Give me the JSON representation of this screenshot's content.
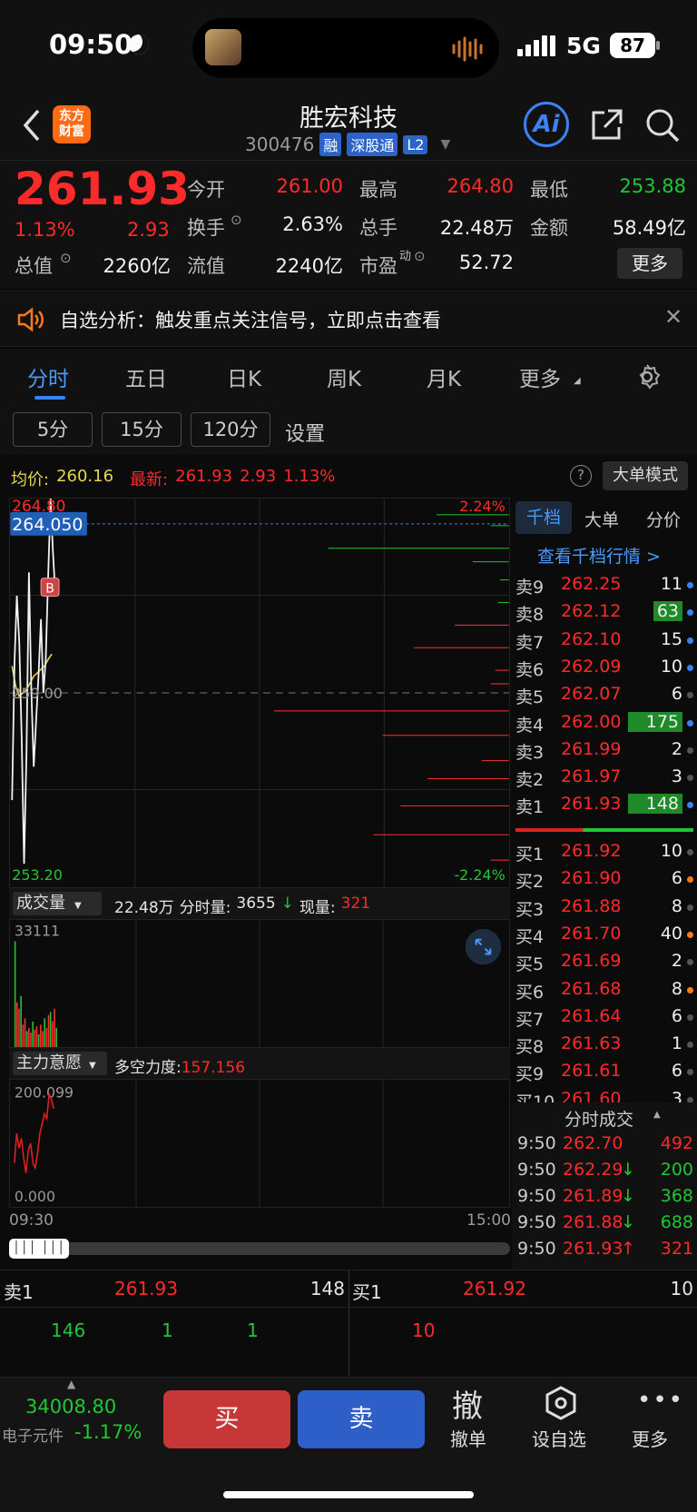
{
  "status_bar": {
    "time": "09:50",
    "network": "5G",
    "battery": "87"
  },
  "header": {
    "logo_line1": "东方",
    "logo_line2": "财富",
    "title": "胜宏科技",
    "code": "300476",
    "tags": [
      "融",
      "深股通",
      "L2"
    ],
    "ai_label": "Ai"
  },
  "quote": {
    "price": "261.93",
    "pct": "1.13%",
    "change": "2.93",
    "today_open_label": "今开",
    "today_open": "261.00",
    "high_label": "最高",
    "high": "264.80",
    "low_label": "最低",
    "low": "253.88",
    "turnover_label": "换手",
    "turnover": "2.63%",
    "volume_label": "总手",
    "volume": "22.48万",
    "amount_label": "金额",
    "amount": "58.49亿",
    "mktcap_label": "总值",
    "mktcap": "2260亿",
    "float_label": "流值",
    "float": "2240亿",
    "pe_label": "市盈",
    "pe_sup": "动",
    "pe": "52.72",
    "more": "更多"
  },
  "notice": {
    "text": "自选分析：触发重点关注信号，立即点击查看"
  },
  "tabs": [
    "分时",
    "五日",
    "日K",
    "周K",
    "月K",
    "更多"
  ],
  "subtabs": [
    "5分",
    "15分",
    "120分"
  ],
  "settings_label": "设置",
  "infobar": {
    "avg_label": "均价:",
    "avg": "260.16",
    "latest_label": "最新:",
    "latest": "261.93",
    "change": "2.93",
    "pct": "1.13%",
    "mode": "大单模式"
  },
  "chart_data": {
    "type": "line",
    "title": "",
    "x_start": "09:30",
    "x_end": "15:00",
    "y_top": "264.80",
    "y_bottom": "253.20",
    "pct_top": "2.24%",
    "pct_bottom": "-2.24%",
    "crosshair": "264.050",
    "ref_price": "259.00",
    "marker": "B",
    "price_series": [
      255.8,
      259.9,
      261.9,
      260.5,
      257.6,
      253.9,
      257.2,
      262.6,
      259.1,
      256.8,
      258.2,
      259.5,
      261.2,
      259.0,
      260.0,
      262.5,
      264.8,
      263.2,
      261.9
    ],
    "avg_series": [
      259.8,
      259.2,
      258.9,
      259.0,
      259.1,
      259.3,
      259.5,
      259.6,
      259.7,
      259.8,
      260.0,
      260.16
    ]
  },
  "volume": {
    "label": "成交量",
    "total": "22.48万",
    "minute_label": "分时量:",
    "minute": "3655",
    "now_label": "现量:",
    "now": "321",
    "max": "33111",
    "bars": [
      33111,
      14000,
      12000,
      16000,
      7000,
      9000,
      5000,
      6000,
      4500,
      8000,
      5500,
      6500,
      4000,
      7000,
      5000,
      9000,
      6000,
      10000,
      11000,
      8000,
      12000,
      6000
    ]
  },
  "zhuli": {
    "label": "主力意愿",
    "strength_label": "多空力度:",
    "strength": "157.156",
    "max": "200.099",
    "min": "0.000",
    "series": [
      60,
      120,
      90,
      110,
      70,
      40,
      85,
      100,
      60,
      50,
      80,
      120,
      140,
      160,
      150,
      200,
      190,
      170
    ]
  },
  "orderbook": {
    "tabs": [
      "千档",
      "大单",
      "分价"
    ],
    "link": "查看千档行情 >",
    "asks": [
      {
        "label": "卖9",
        "price": "262.25",
        "vol": "11"
      },
      {
        "label": "卖8",
        "price": "262.12",
        "vol": "63"
      },
      {
        "label": "卖7",
        "price": "262.10",
        "vol": "15"
      },
      {
        "label": "卖6",
        "price": "262.09",
        "vol": "10"
      },
      {
        "label": "卖5",
        "price": "262.07",
        "vol": "6"
      },
      {
        "label": "卖4",
        "price": "262.00",
        "vol": "175"
      },
      {
        "label": "卖3",
        "price": "261.99",
        "vol": "2"
      },
      {
        "label": "卖2",
        "price": "261.97",
        "vol": "3"
      },
      {
        "label": "卖1",
        "price": "261.93",
        "vol": "148"
      }
    ],
    "bids": [
      {
        "label": "买1",
        "price": "261.92",
        "vol": "10"
      },
      {
        "label": "买2",
        "price": "261.90",
        "vol": "6"
      },
      {
        "label": "买3",
        "price": "261.88",
        "vol": "8"
      },
      {
        "label": "买4",
        "price": "261.70",
        "vol": "40"
      },
      {
        "label": "买5",
        "price": "261.69",
        "vol": "2"
      },
      {
        "label": "买6",
        "price": "261.68",
        "vol": "8"
      },
      {
        "label": "买7",
        "price": "261.64",
        "vol": "6"
      },
      {
        "label": "买8",
        "price": "261.63",
        "vol": "1"
      },
      {
        "label": "买9",
        "price": "261.61",
        "vol": "6"
      },
      {
        "label": "买10",
        "price": "261.60",
        "vol": "3"
      }
    ],
    "trades_label": "分时成交",
    "trades": [
      {
        "t": "9:50",
        "p": "262.70",
        "v": "492",
        "d": ""
      },
      {
        "t": "9:50",
        "p": "262.29",
        "v": "200",
        "d": "↓"
      },
      {
        "t": "9:50",
        "p": "261.89",
        "v": "368",
        "d": "↓"
      },
      {
        "t": "9:50",
        "p": "261.88",
        "v": "688",
        "d": "↓"
      },
      {
        "t": "9:50",
        "p": "261.93",
        "v": "321",
        "d": "↑"
      }
    ]
  },
  "bottom_quote": {
    "sell_label": "卖1",
    "sell_price": "261.93",
    "sell_vol": "148",
    "buy_label": "买1",
    "buy_price": "261.92",
    "buy_vol": "10",
    "sell_queue": [
      "146",
      "1",
      "1"
    ],
    "buy_queue": [
      "10"
    ]
  },
  "toolbar": {
    "index_value": "34008.80",
    "index_name": "电子元件",
    "index_pct": "-1.17%",
    "buy": "买",
    "sell": "卖",
    "cancel_glyph": "撤",
    "cancel": "撤单",
    "watch": "设自选",
    "more": "更多"
  }
}
